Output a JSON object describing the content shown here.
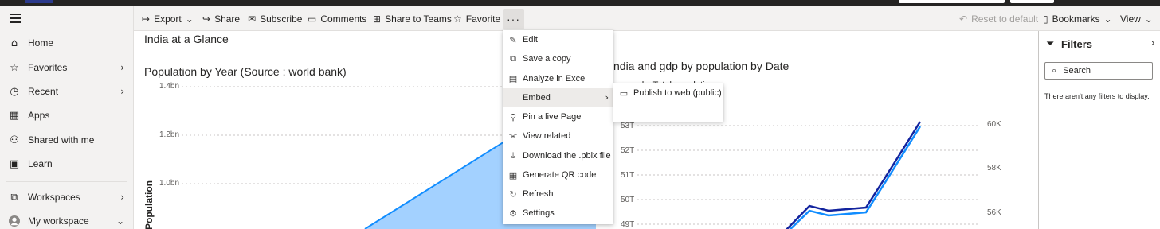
{
  "left_nav": {
    "items": [
      {
        "label": "Home",
        "icon": "home-icon"
      },
      {
        "label": "Favorites",
        "icon": "star-icon"
      },
      {
        "label": "Recent",
        "icon": "clock-icon"
      },
      {
        "label": "Apps",
        "icon": "apps-icon"
      },
      {
        "label": "Shared with me",
        "icon": "person-share-icon"
      },
      {
        "label": "Learn",
        "icon": "book-icon"
      },
      {
        "label": "Workspaces",
        "icon": "workspaces-icon"
      },
      {
        "label": "My workspace",
        "icon": "avatar-icon"
      }
    ]
  },
  "toolbar": {
    "export": "Export",
    "share": "Share",
    "subscribe": "Subscribe",
    "comments": "Comments",
    "share_to_teams": "Share to Teams",
    "favorite": "Favorite",
    "more": "···",
    "reset": "Reset to default",
    "bookmarks": "Bookmarks",
    "view": "View"
  },
  "report": {
    "page_title": "India at a Glance",
    "visual1_title": "Population by Year (Source : world bank)",
    "visual1_y_ticks": [
      "1.4bn",
      "1.2bn",
      "1.0bn"
    ],
    "visual1_y_label": "Population",
    "visual2_title": "ndia and gdp by population by Date",
    "visual2_legend": "ndia   Total population",
    "visual2_left_ticks": [
      "53T",
      "52T",
      "51T",
      "50T",
      "49T"
    ],
    "visual2_right_ticks": [
      "60K",
      "58K",
      "56K"
    ]
  },
  "more_menu": {
    "items": [
      {
        "label": "Edit",
        "icon": "edit-icon"
      },
      {
        "label": "Save a copy",
        "icon": "copy-icon"
      },
      {
        "label": "Analyze in Excel",
        "icon": "excel-icon"
      },
      {
        "label": "Embed",
        "icon": "",
        "has_submenu": true
      },
      {
        "label": "Pin a live Page",
        "icon": "pin-icon"
      },
      {
        "label": "View related",
        "icon": "related-icon"
      },
      {
        "label": "Download the .pbix file",
        "icon": "download-icon"
      },
      {
        "label": "Generate QR code",
        "icon": "qr-icon"
      },
      {
        "label": "Refresh",
        "icon": "refresh-icon"
      },
      {
        "label": "Settings",
        "icon": "settings-icon"
      }
    ],
    "submenu": {
      "label": "Publish to web (public)",
      "icon": "publish-web-icon"
    }
  },
  "filters": {
    "title": "Filters",
    "search_placeholder": "Search",
    "empty_text": "There aren't any filters to display."
  },
  "colors": {
    "area_fill": "#a3d1ff",
    "line_blue": "#118dff",
    "line_dark": "#12239e"
  }
}
